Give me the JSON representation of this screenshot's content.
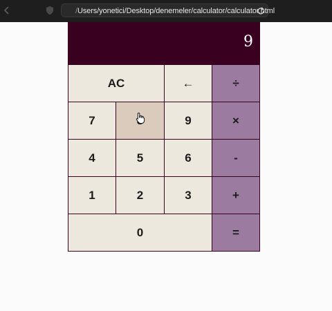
{
  "browser": {
    "url_prefix": "/",
    "url_path": "Users/yonetici/Desktop/denemeler/calculator/calculator.html"
  },
  "calculator": {
    "display_value": "9",
    "keys": {
      "clear": "AC",
      "backspace": "←",
      "divide": "÷",
      "seven": "7",
      "eight": "8",
      "nine": "9",
      "multiply": "×",
      "four": "4",
      "five": "5",
      "six": "6",
      "subtract": "-",
      "one": "1",
      "two": "2",
      "three": "3",
      "add": "+",
      "zero": "0",
      "equals": "="
    }
  },
  "colors": {
    "display_bg": "#3a0020",
    "key_bg": "#ece8de",
    "key_hover_bg": "#dbcbbd",
    "operator_bg": "#9b7ba0",
    "chrome_bg": "#1e1e1e"
  }
}
